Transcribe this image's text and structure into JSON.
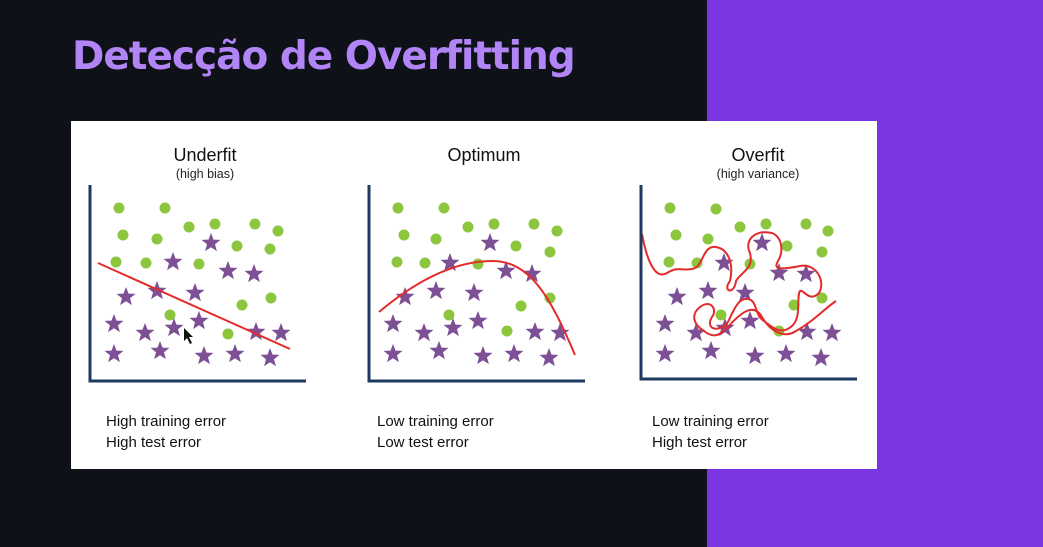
{
  "slide": {
    "title": "Detecção de Overfitting",
    "colors": {
      "background": "#0f1118",
      "accent": "#7c35e3",
      "title": "#b185f5"
    }
  },
  "colors": {
    "circle": "#8cc63f",
    "star": "#7d4f94",
    "curve": "#e32b2b",
    "axis": "#1f3a5f"
  },
  "panels": [
    {
      "id": "underfit",
      "title": "Underfit",
      "subtitle": "(high bias)",
      "curve": "linear",
      "errors": [
        "High training error",
        "High test error"
      ]
    },
    {
      "id": "optimum",
      "title": "Optimum",
      "subtitle": "",
      "curve": "smooth-arc",
      "errors": [
        "Low training error",
        "Low test error"
      ]
    },
    {
      "id": "overfit",
      "title": "Overfit",
      "subtitle": "(high variance)",
      "curve": "wiggly",
      "errors": [
        "Low training error",
        "High test error"
      ]
    }
  ]
}
